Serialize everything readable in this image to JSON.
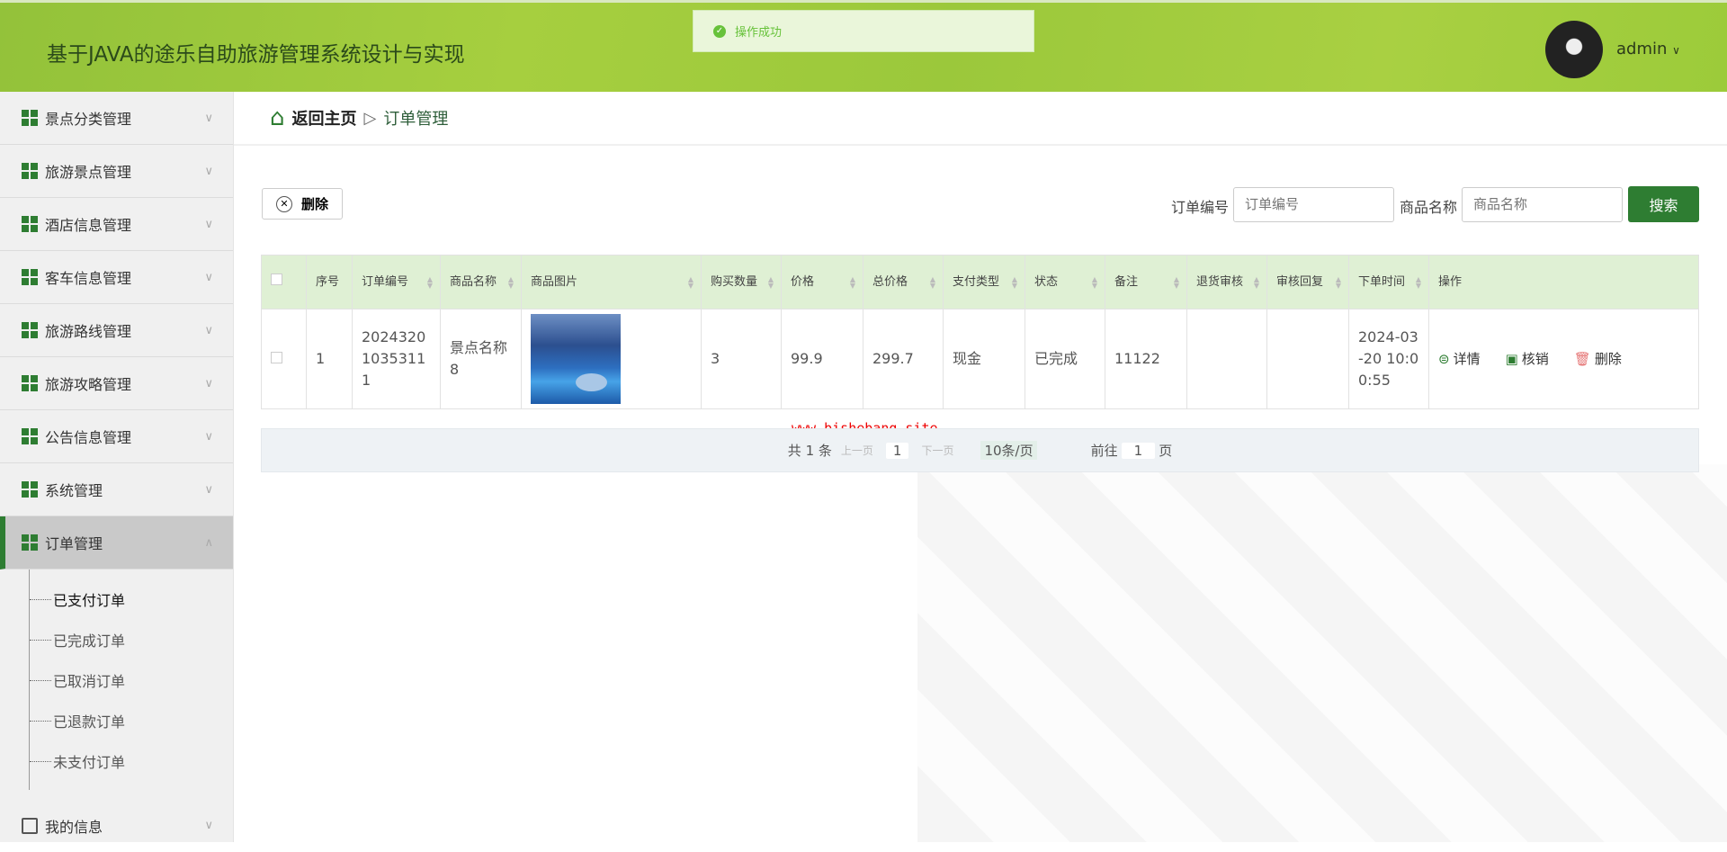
{
  "header": {
    "title": "基于JAVA的途乐自助旅游管理系统设计与实现",
    "user": "admin",
    "toast": "操作成功"
  },
  "sidebar": {
    "items": [
      {
        "label": "景点分类管理",
        "icon": "clipboard-check-icon"
      },
      {
        "label": "旅游景点管理",
        "icon": "clipboard-x-icon"
      },
      {
        "label": "酒店信息管理",
        "icon": "grid-icon"
      },
      {
        "label": "客车信息管理",
        "icon": "grid-icon"
      },
      {
        "label": "旅游路线管理",
        "icon": "wallet-icon"
      },
      {
        "label": "旅游攻略管理",
        "icon": "lightbulb-icon"
      },
      {
        "label": "公告信息管理",
        "icon": "grid-icon"
      },
      {
        "label": "系统管理",
        "icon": "grid-icon"
      },
      {
        "label": "订单管理",
        "icon": "grid-icon"
      }
    ],
    "sub": [
      "已支付订单",
      "已完成订单",
      "已取消订单",
      "已退款订单",
      "未支付订单"
    ],
    "last": {
      "label": "我的信息",
      "icon": "card-icon"
    }
  },
  "breadcrumb": {
    "home": "返回主页",
    "current": "订单管理"
  },
  "toolbar": {
    "delete": "删除",
    "order_no_label": "订单编号",
    "order_no_placeholder": "订单编号",
    "goods_label": "商品名称",
    "goods_placeholder": "商品名称",
    "search": "搜索"
  },
  "table": {
    "headers": [
      "序号",
      "订单编号",
      "商品名称",
      "商品图片",
      "购买数量",
      "价格",
      "总价格",
      "支付类型",
      "状态",
      "备注",
      "退货审核",
      "审核回复",
      "下单时间",
      "操作"
    ],
    "rows": [
      {
        "no": "1",
        "order_no": "202432010353111",
        "goods": "景点名称8",
        "qty": "3",
        "price": "99.9",
        "total": "299.7",
        "pay": "现金",
        "status": "已完成",
        "remark": "11122",
        "return_review": "",
        "reply": "",
        "time": "2024-03-20 10:00:55"
      }
    ],
    "actions": [
      "详情",
      "核销",
      "删除"
    ]
  },
  "watermark": "www.bishebang.site",
  "pager": {
    "total": "共 1 条",
    "prev": "上一页",
    "page": "1",
    "next": "下一页",
    "size": "10条/页",
    "goto": "前往",
    "goto_page": "1",
    "page_unit": "页"
  }
}
